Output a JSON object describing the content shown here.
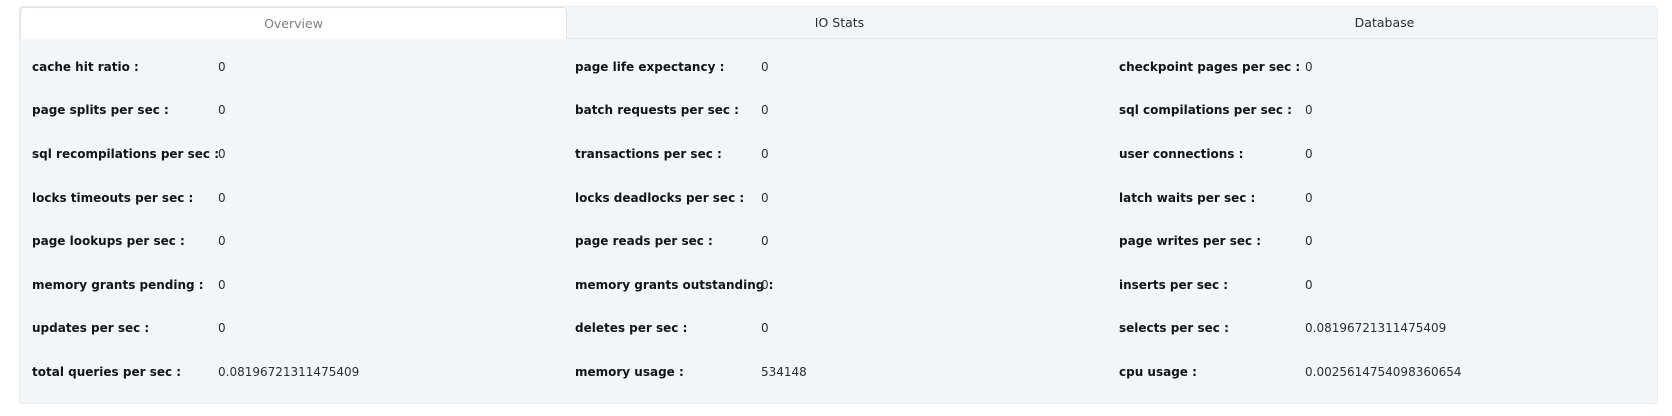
{
  "tabs": [
    {
      "label": "Overview",
      "active": true
    },
    {
      "label": "IO Stats",
      "active": false
    },
    {
      "label": "Database",
      "active": false
    }
  ],
  "metrics": [
    [
      {
        "label": "cache hit ratio :",
        "value": "0"
      },
      {
        "label": "page life expectancy :",
        "value": "0"
      },
      {
        "label": "checkpoint pages per sec :",
        "value": "0"
      }
    ],
    [
      {
        "label": "page splits per sec :",
        "value": "0"
      },
      {
        "label": "batch requests per sec :",
        "value": "0"
      },
      {
        "label": "sql compilations per sec :",
        "value": "0"
      }
    ],
    [
      {
        "label": "sql recompilations per sec :",
        "value": "0"
      },
      {
        "label": "transactions per sec :",
        "value": "0"
      },
      {
        "label": "user connections :",
        "value": "0"
      }
    ],
    [
      {
        "label": "locks timeouts per sec :",
        "value": "0"
      },
      {
        "label": "locks deadlocks per sec :",
        "value": "0"
      },
      {
        "label": "latch waits per sec :",
        "value": "0"
      }
    ],
    [
      {
        "label": "page lookups per sec :",
        "value": "0"
      },
      {
        "label": "page reads per sec :",
        "value": "0"
      },
      {
        "label": "page writes per sec :",
        "value": "0"
      }
    ],
    [
      {
        "label": "memory grants pending :",
        "value": "0"
      },
      {
        "label": "memory grants outstanding :",
        "value": "0"
      },
      {
        "label": "inserts per sec :",
        "value": "0"
      }
    ],
    [
      {
        "label": "updates per sec :",
        "value": "0"
      },
      {
        "label": "deletes per sec :",
        "value": "0"
      },
      {
        "label": "selects per sec :",
        "value": "0.08196721311475409"
      }
    ],
    [
      {
        "label": "total queries per sec :",
        "value": "0.08196721311475409"
      },
      {
        "label": "memory usage :",
        "value": "534148"
      },
      {
        "label": "cpu usage :",
        "value": "0.0025614754098360654"
      }
    ]
  ]
}
